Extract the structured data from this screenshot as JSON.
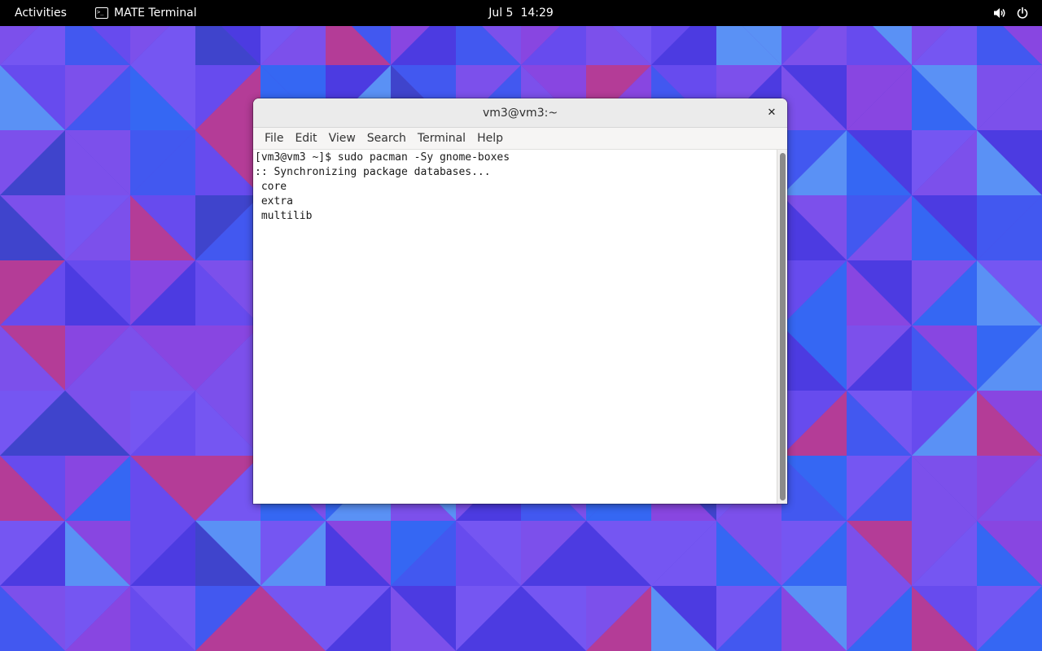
{
  "topbar": {
    "activities_label": "Activities",
    "app_name": "MATE Terminal",
    "app_icon_glyph": ">_",
    "date": "Jul 5",
    "time": "14:29",
    "icons": [
      "volume-icon",
      "power-icon"
    ]
  },
  "window": {
    "title": "vm3@vm3:~",
    "close_glyph": "✕",
    "menu": [
      "File",
      "Edit",
      "View",
      "Search",
      "Terminal",
      "Help"
    ]
  },
  "terminal": {
    "lines": [
      "[vm3@vm3 ~]$ sudo pacman -Sy gnome-boxes",
      ":: Synchronizing package databases...",
      " core",
      " extra",
      " multilib"
    ]
  },
  "colors": {
    "wallpaper_base": "#5a3fe0",
    "wallpaper_palette": [
      "#4a3be0",
      "#6a4ef0",
      "#3e5df2",
      "#2f6ff6",
      "#8254ec",
      "#7a5bf4",
      "#9048e0",
      "#c43c8a",
      "#3b45c8",
      "#5aa0f8"
    ]
  }
}
